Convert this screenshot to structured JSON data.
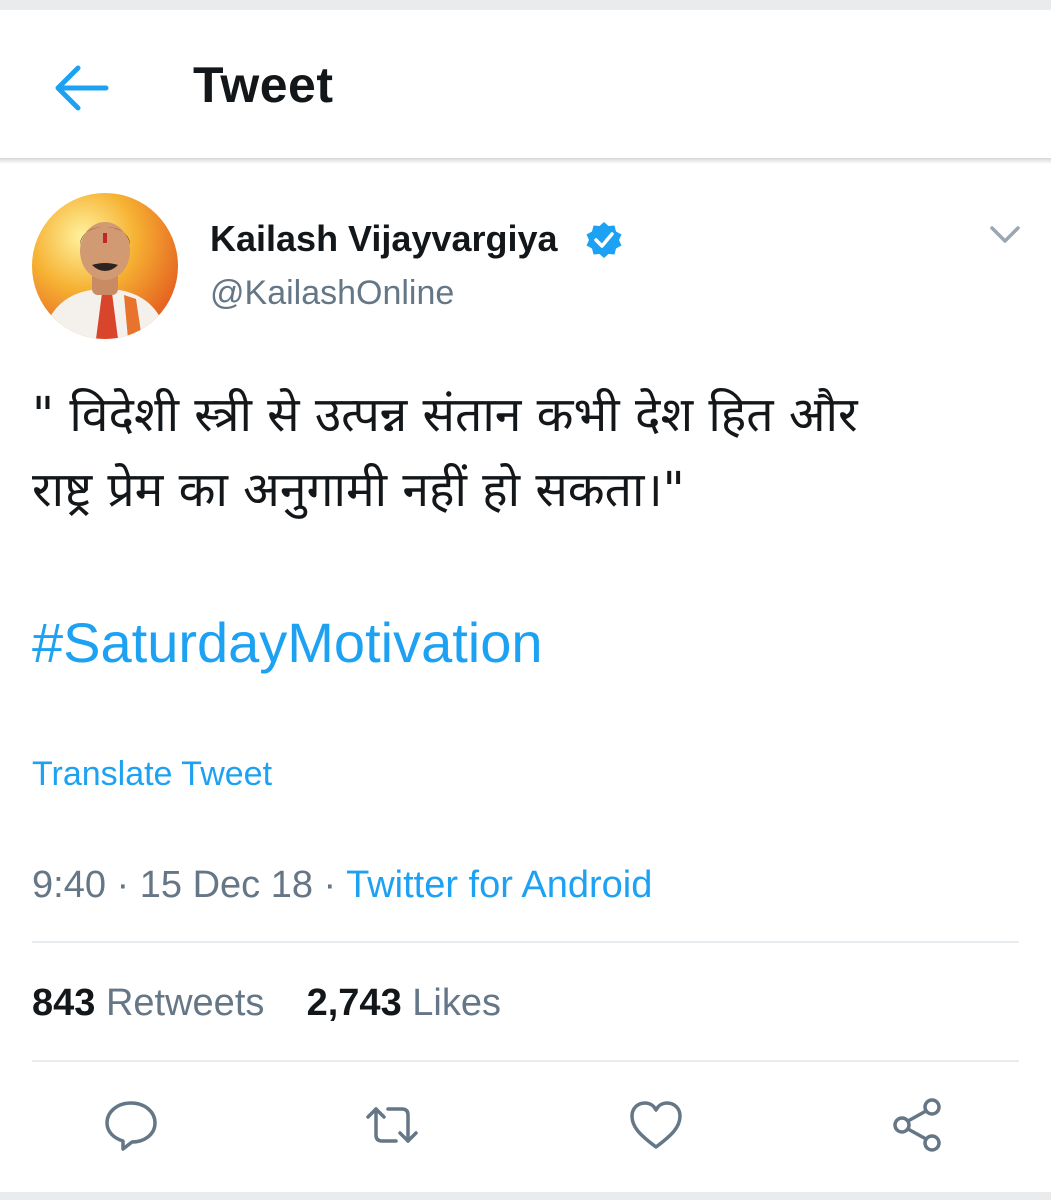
{
  "header": {
    "title": "Tweet",
    "back_icon": "arrow-left-icon"
  },
  "author": {
    "name": "Kailash Vijayvargiya",
    "handle": "@KailashOnline",
    "verified": true
  },
  "tweet": {
    "text": "\" विदेशी स्त्री से उत्पन्न संतान कभी देश हित और\nराष्ट्र प्रेम का अनुगामी नहीं हो सकता।\"",
    "hashtag": "#SaturdayMotivation",
    "translate_label": "Translate Tweet",
    "time": "9:40",
    "date": "15 Dec 18",
    "separator": " · ",
    "source": "Twitter for Android"
  },
  "stats": {
    "retweets_count": "843",
    "retweets_label": "Retweets",
    "likes_count": "2,743",
    "likes_label": "Likes"
  },
  "actions": [
    "reply-icon",
    "retweet-icon",
    "like-icon",
    "share-icon"
  ],
  "colors": {
    "accent": "#1da1f2",
    "text": "#14171a",
    "secondary": "#657786",
    "icon": "#657786"
  }
}
